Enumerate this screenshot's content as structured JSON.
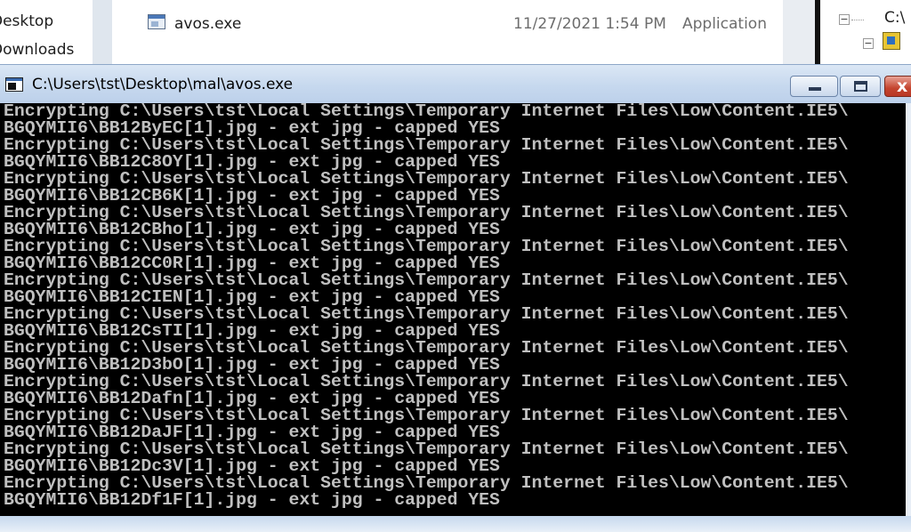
{
  "background_explorer": {
    "nav_items": [
      "Desktop",
      "Downloads"
    ],
    "file": {
      "name": "avos.exe",
      "date_modified": "11/27/2021 1:54 PM",
      "type": "Application"
    },
    "tree_label": "C:\\",
    "tree_toggle": "−"
  },
  "console": {
    "title": "C:\\Users\\tst\\Desktop\\mal\\avos.exe",
    "minimize_label": "",
    "maximize_label": "",
    "close_label": "x",
    "lines": [
      "Encrypting C:\\Users\\tst\\Local Settings\\Temporary Internet Files\\Low\\Content.IE5\\",
      "BGQYMII6\\BB12ByEC[1].jpg - ext jpg - capped YES",
      "Encrypting C:\\Users\\tst\\Local Settings\\Temporary Internet Files\\Low\\Content.IE5\\",
      "BGQYMII6\\BB12C8OY[1].jpg - ext jpg - capped YES",
      "Encrypting C:\\Users\\tst\\Local Settings\\Temporary Internet Files\\Low\\Content.IE5\\",
      "BGQYMII6\\BB12CB6K[1].jpg - ext jpg - capped YES",
      "Encrypting C:\\Users\\tst\\Local Settings\\Temporary Internet Files\\Low\\Content.IE5\\",
      "BGQYMII6\\BB12CBho[1].jpg - ext jpg - capped YES",
      "Encrypting C:\\Users\\tst\\Local Settings\\Temporary Internet Files\\Low\\Content.IE5\\",
      "BGQYMII6\\BB12CC0R[1].jpg - ext jpg - capped YES",
      "Encrypting C:\\Users\\tst\\Local Settings\\Temporary Internet Files\\Low\\Content.IE5\\",
      "BGQYMII6\\BB12CIEN[1].jpg - ext jpg - capped YES",
      "Encrypting C:\\Users\\tst\\Local Settings\\Temporary Internet Files\\Low\\Content.IE5\\",
      "BGQYMII6\\BB12CsTI[1].jpg - ext jpg - capped YES",
      "Encrypting C:\\Users\\tst\\Local Settings\\Temporary Internet Files\\Low\\Content.IE5\\",
      "BGQYMII6\\BB12D3bO[1].jpg - ext jpg - capped YES",
      "Encrypting C:\\Users\\tst\\Local Settings\\Temporary Internet Files\\Low\\Content.IE5\\",
      "BGQYMII6\\BB12Dafn[1].jpg - ext jpg - capped YES",
      "Encrypting C:\\Users\\tst\\Local Settings\\Temporary Internet Files\\Low\\Content.IE5\\",
      "BGQYMII6\\BB12DaJF[1].jpg - ext jpg - capped YES",
      "Encrypting C:\\Users\\tst\\Local Settings\\Temporary Internet Files\\Low\\Content.IE5\\",
      "BGQYMII6\\BB12Dc3V[1].jpg - ext jpg - capped YES",
      "Encrypting C:\\Users\\tst\\Local Settings\\Temporary Internet Files\\Low\\Content.IE5\\",
      "BGQYMII6\\BB12Df1F[1].jpg - ext jpg - capped YES"
    ]
  },
  "icons": {
    "app_icon": "console-app-icon",
    "file_icon": "exe-file-icon",
    "tree_icon": "folder-tree-icon"
  },
  "colors": {
    "console_background": "#000000",
    "console_text": "#c0c0c0",
    "title_bar": "#c6d8ee",
    "close_button": "#c4442e"
  }
}
